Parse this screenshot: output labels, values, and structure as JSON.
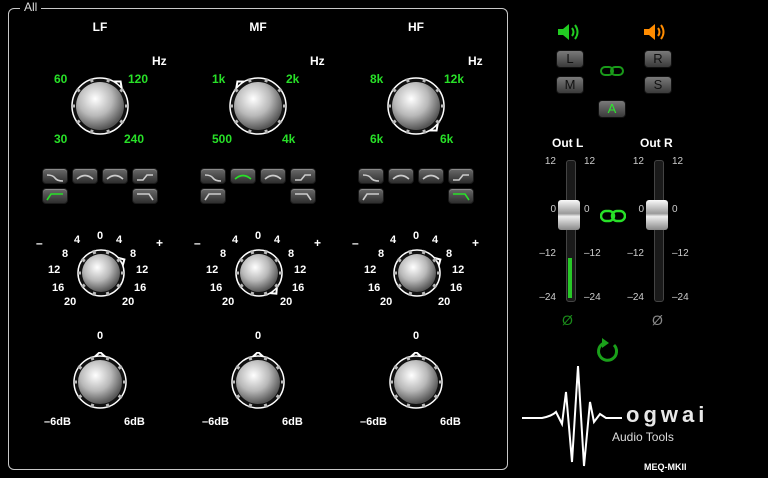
{
  "frame_label": "All",
  "bands": [
    {
      "title": "LF",
      "hz": "Hz",
      "freq": {
        "tl": "60",
        "tr": "120",
        "bl": "30",
        "br": "240"
      }
    },
    {
      "title": "MF",
      "hz": "Hz",
      "freq": {
        "tl": "1k",
        "tr": "2k",
        "bl": "500",
        "br": "4k"
      }
    },
    {
      "title": "HF",
      "hz": "Hz",
      "freq": {
        "tl": "8k",
        "tr": "12k",
        "bl": "6k",
        "br": "6k"
      }
    }
  ],
  "gain_scale": {
    "minus": "–",
    "plus": "+",
    "zero": "0",
    "l4": "4",
    "r4": "4",
    "l8": "8",
    "r8": "8",
    "l12": "12",
    "r12": "12",
    "l16": "16",
    "r16": "16",
    "l20": "20",
    "r20": "20"
  },
  "trim_scale": {
    "zero": "0",
    "left": "–6dB",
    "right": "6dB"
  },
  "side": {
    "L": "L",
    "R": "R",
    "M": "M",
    "S": "S",
    "A": "A",
    "out_l": "Out L",
    "out_r": "Out R",
    "ticks": [
      "12",
      "0",
      "–12",
      "–24"
    ],
    "phase": "Ø",
    "brand": "ogwai",
    "brand_sub": "Audio Tools",
    "model": "MEQ-MKII"
  },
  "colors": {
    "accent_green": "#28e028",
    "speaker_left": "#22cc22",
    "speaker_right": "#ff8c00"
  }
}
